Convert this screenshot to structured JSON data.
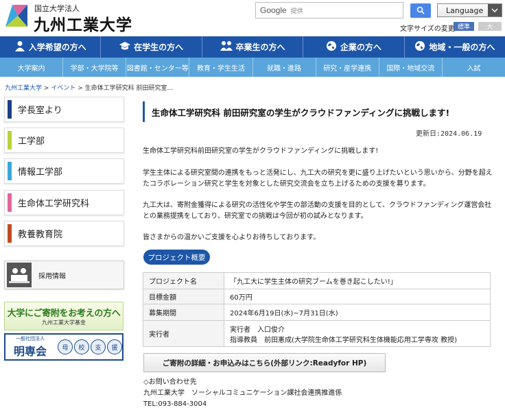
{
  "header": {
    "logo_sub": "国立大学法人",
    "logo_main": "九州工業大学",
    "search_brand": "Google",
    "search_placeholder": "提供",
    "language_label": "Language",
    "fontsize_label": "文字サイズの変更",
    "fontsize_standard": "標準",
    "fontsize_large": "大"
  },
  "nav_main": [
    {
      "label": "入学希望の方へ",
      "icon": "person-icon"
    },
    {
      "label": "在学生の方へ",
      "icon": "graduation-cap-icon"
    },
    {
      "label": "卒業生の方へ",
      "icon": "people-icon"
    },
    {
      "label": "企業の方へ",
      "icon": "globe-icon"
    },
    {
      "label": "地域・一般の方へ",
      "icon": "globe-icon"
    }
  ],
  "nav_sub": [
    "大学案内",
    "学部・大学院等",
    "図書館・センター等",
    "教育・学生生活",
    "就職・進路",
    "研究・産学連携",
    "国際・地域交流",
    "入試"
  ],
  "breadcrumb": {
    "home": "九州工業大学",
    "sep": ">",
    "events": "イベント",
    "current": "生命体工学研究科 前田研究室..."
  },
  "sidebar": {
    "items": [
      {
        "label": "学長室より",
        "color": "#1d3f8a"
      },
      {
        "label": "工学部",
        "color": "#b7d23a"
      },
      {
        "label": "情報工学部",
        "color": "#3aa7de"
      },
      {
        "label": "生命体工学研究科",
        "color": "#e0669e"
      },
      {
        "label": "教養教育院",
        "color": "#c14a1e"
      }
    ],
    "recruit_label": "採用情報",
    "donate_title": "大学にご寄附をお考えの方へ",
    "donate_sub": "九州工業大学基金",
    "meimei_sub": "一般社団法人",
    "meimei_main": "明専会",
    "meimei_circles": [
      "母",
      "校",
      "支",
      "援",
      "同",
      "窓",
      "会"
    ]
  },
  "article": {
    "title": "生命体工学研究科 前田研究室の学生がクラウドファンディングに挑戦します!",
    "updated": "更新日:2024.06.19",
    "p1": "生命体工学研究科前田研究室の学生がクラウドファンディングに挑戦します!",
    "p2": "学生主体による研究室間の連携をもっと活発にし、九工大の研究を更に盛り上げたいという思いから、分野を超えたコラボレーション研究と学生を対象とした研究交流会を立ち上げるための支援を募ります。",
    "p3": "九工大は、寄附金獲得による研究の活性化や学生の部活動の支援を目的として、クラウドファンディング運営会社との業務提携をしており、研究室での挑戦は今回が初の試みとなります。",
    "p4": "皆さまからの温かいご支援を心よりお待ちしております。",
    "project_button": "プロジェクト概要",
    "table": [
      {
        "h": "プロジェクト名",
        "v": "「九工大に学生主体の研究ブームを巻き起こしたい!」"
      },
      {
        "h": "目標金額",
        "v": "60万円"
      },
      {
        "h": "募集期間",
        "v": "2024年6月19日(水)~7月31日(水)"
      },
      {
        "h": "実行者",
        "v": "実行者　入口俊介",
        "v2": "指導教員　前田憲成(大学院生命体工学研究科生体機能応用工学専攻 教授)"
      }
    ],
    "cta": "ご寄附の詳細・お申込みはこちら(外部リンク:Readyfor HP)",
    "contact_title": "◇お問い合わせ先",
    "contact_org": "九州工業大学　ソーシャルコミュニケーション課社会連携推進係",
    "contact_tel": "TEL:093-884-3004"
  }
}
